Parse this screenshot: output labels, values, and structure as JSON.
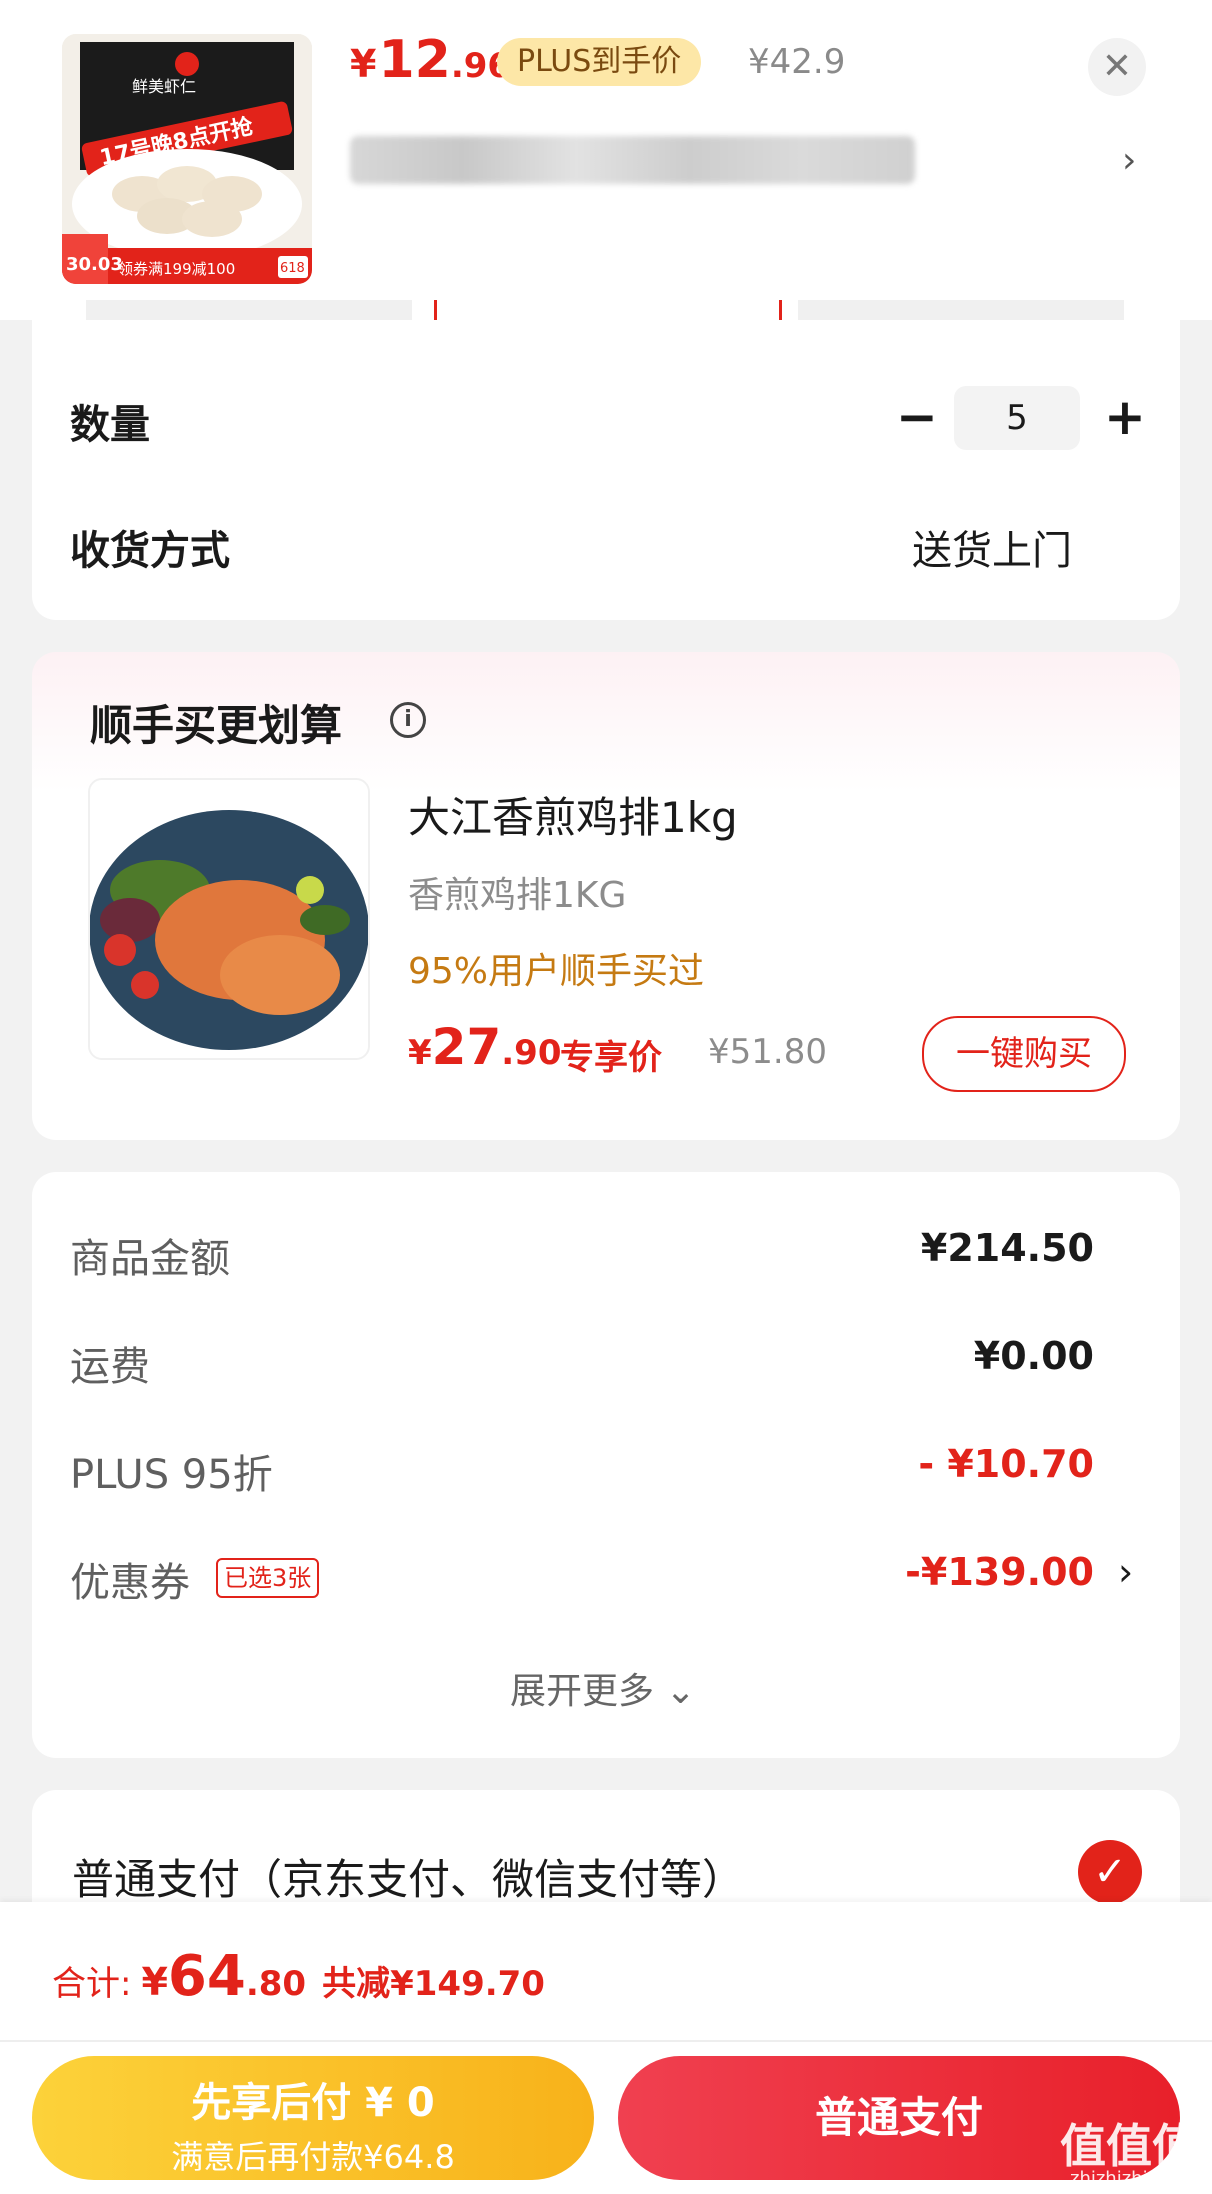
{
  "header": {
    "price_currency": "¥",
    "price_int": "12",
    "price_dec": ".96",
    "price_tag": "PLUS到手价",
    "original_price": "¥42.9",
    "close_symbol": "✕",
    "arrow": "›",
    "product_image_text": {
      "brand": "鲜美虾仁",
      "banner": "17号晚8点开抢",
      "promo_price": "30.03",
      "coupon": "领券满199减100",
      "tag": "618"
    }
  },
  "order": {
    "quantity_label": "数量",
    "quantity_value": "5",
    "minus": "−",
    "plus": "+",
    "shipping_label": "收货方式",
    "shipping_value": "送货上门"
  },
  "addon": {
    "title": "顺手买更划算",
    "info_icon": "i",
    "product": {
      "name": "大江香煎鸡排1kg",
      "spec": "香煎鸡排1KG",
      "hint": "95%用户顺手买过",
      "price_currency": "¥",
      "price_int": "27",
      "price_dec": ".90",
      "price_tag": "专享价",
      "original_price": "¥51.80",
      "button": "一键购买"
    }
  },
  "summary": {
    "rows": [
      {
        "label": "商品金额",
        "value": "¥214.50"
      },
      {
        "label": "运费",
        "value": "¥0.00"
      },
      {
        "label": "PLUS 95折",
        "value": "- ¥10.70"
      },
      {
        "label": "优惠券",
        "value": "-¥139.00"
      }
    ],
    "coupon_tag": "已选3张",
    "coupon_arrow": "›",
    "expand": "展开更多 ⌄"
  },
  "payment": {
    "option": "普通支付（京东支付、微信支付等）",
    "check": "✓"
  },
  "footer": {
    "total_label": "合计:",
    "total_currency": "¥",
    "total_int": "64",
    "total_dec": ".80",
    "saved": "共减¥149.70",
    "btn_later_line1": "先享后付 ¥ 0",
    "btn_later_line2": "满意后再付款¥64.8",
    "btn_pay": "普通支付",
    "watermark": "值值值",
    "watermark_sub": "zhizhizhi.com"
  },
  "colors": {
    "accent_red": "#e2231a",
    "plus_gold": "#fde7a7",
    "pay_later_yellow": "#f8b21a"
  }
}
